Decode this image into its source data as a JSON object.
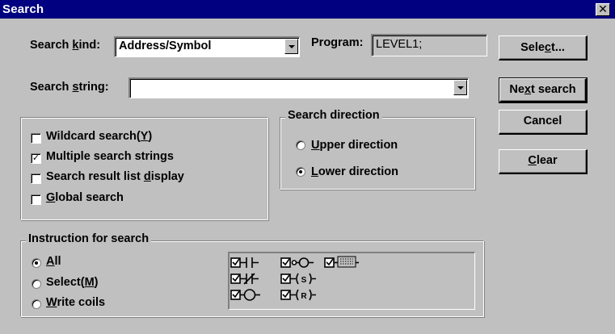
{
  "window": {
    "title": "Search",
    "close_glyph": "✕"
  },
  "search_kind": {
    "label_pre": "Search ",
    "label_key": "k",
    "label_post": "ind:",
    "value": "Address/Symbol"
  },
  "program": {
    "label": "Program:",
    "value": "LEVEL1;"
  },
  "search_string": {
    "label_pre": "Search ",
    "label_key": "s",
    "label_post": "tring:",
    "value": ""
  },
  "buttons": {
    "select": {
      "pre": "Sele",
      "key": "c",
      "post": "t..."
    },
    "next_search": {
      "pre": "Ne",
      "key": "x",
      "post": "t search"
    },
    "cancel": {
      "pre": "",
      "key": "",
      "post": "Cancel"
    },
    "clear": {
      "pre": "",
      "key": "C",
      "post": "lear"
    }
  },
  "options": [
    {
      "pre": "Wildcard search(",
      "key": "Y",
      "post": ")",
      "checked": false
    },
    {
      "pre": "Multiple search strings",
      "key": "",
      "post": "",
      "checked": true
    },
    {
      "pre": "Search result list ",
      "key": "d",
      "post": "isplay",
      "checked": false
    },
    {
      "pre": "",
      "key": "G",
      "post": "lobal search",
      "checked": false
    }
  ],
  "direction": {
    "title": "Search direction",
    "items": [
      {
        "pre": "",
        "key": "U",
        "post": "pper direction",
        "selected": false
      },
      {
        "pre": "",
        "key": "L",
        "post": "ower direction",
        "selected": true
      }
    ]
  },
  "instruction": {
    "title": "Instruction for search",
    "items": [
      {
        "pre": "",
        "key": "A",
        "post": "ll",
        "selected": true
      },
      {
        "pre": "Select(",
        "key": "M",
        "post": ")",
        "selected": false
      },
      {
        "pre": "",
        "key": "W",
        "post": "rite coils",
        "selected": false
      }
    ],
    "symbols": [
      {
        "icon": "no-contact-icon",
        "checked": true
      },
      {
        "icon": "coil-output-icon",
        "checked": true
      },
      {
        "icon": "function-block-icon",
        "checked": true
      },
      {
        "icon": "nc-contact-icon",
        "checked": true
      },
      {
        "icon": "set-coil-icon",
        "checked": true,
        "text": "S"
      },
      {
        "icon": "output-coil-icon",
        "checked": true
      },
      {
        "icon": "reset-coil-icon",
        "checked": true,
        "text": "R"
      }
    ]
  }
}
